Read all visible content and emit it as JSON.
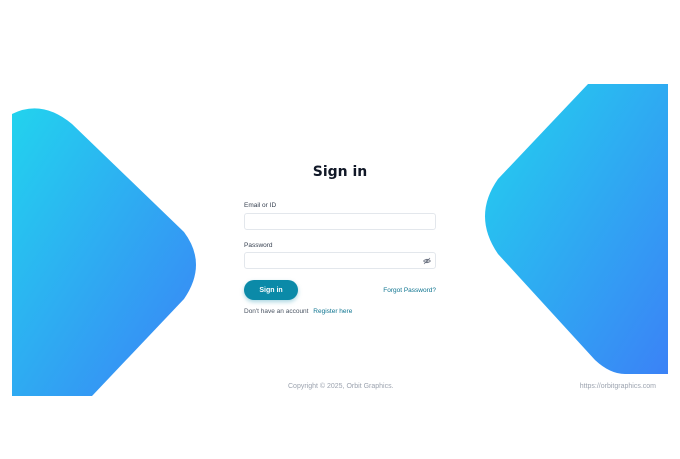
{
  "auth": {
    "title": "Sign in",
    "email_label": "Email or ID",
    "email_value": "",
    "password_label": "Password",
    "password_value": "",
    "signin_button": "Sign in",
    "forgot_link": "Forgot Password?",
    "no_account_text": "Don't have an account",
    "register_link": "Register here"
  },
  "footer": {
    "copyright": "Copyright © 2025, Orbit Graphics.",
    "url": "https://orbitgraphics.com"
  },
  "colors": {
    "primary": "#0b8aa8",
    "link": "#0e7490",
    "gradient_start": "#22d3ee",
    "gradient_end": "#3b82f6"
  },
  "icons": {
    "password_toggle": "eye-off-icon"
  }
}
